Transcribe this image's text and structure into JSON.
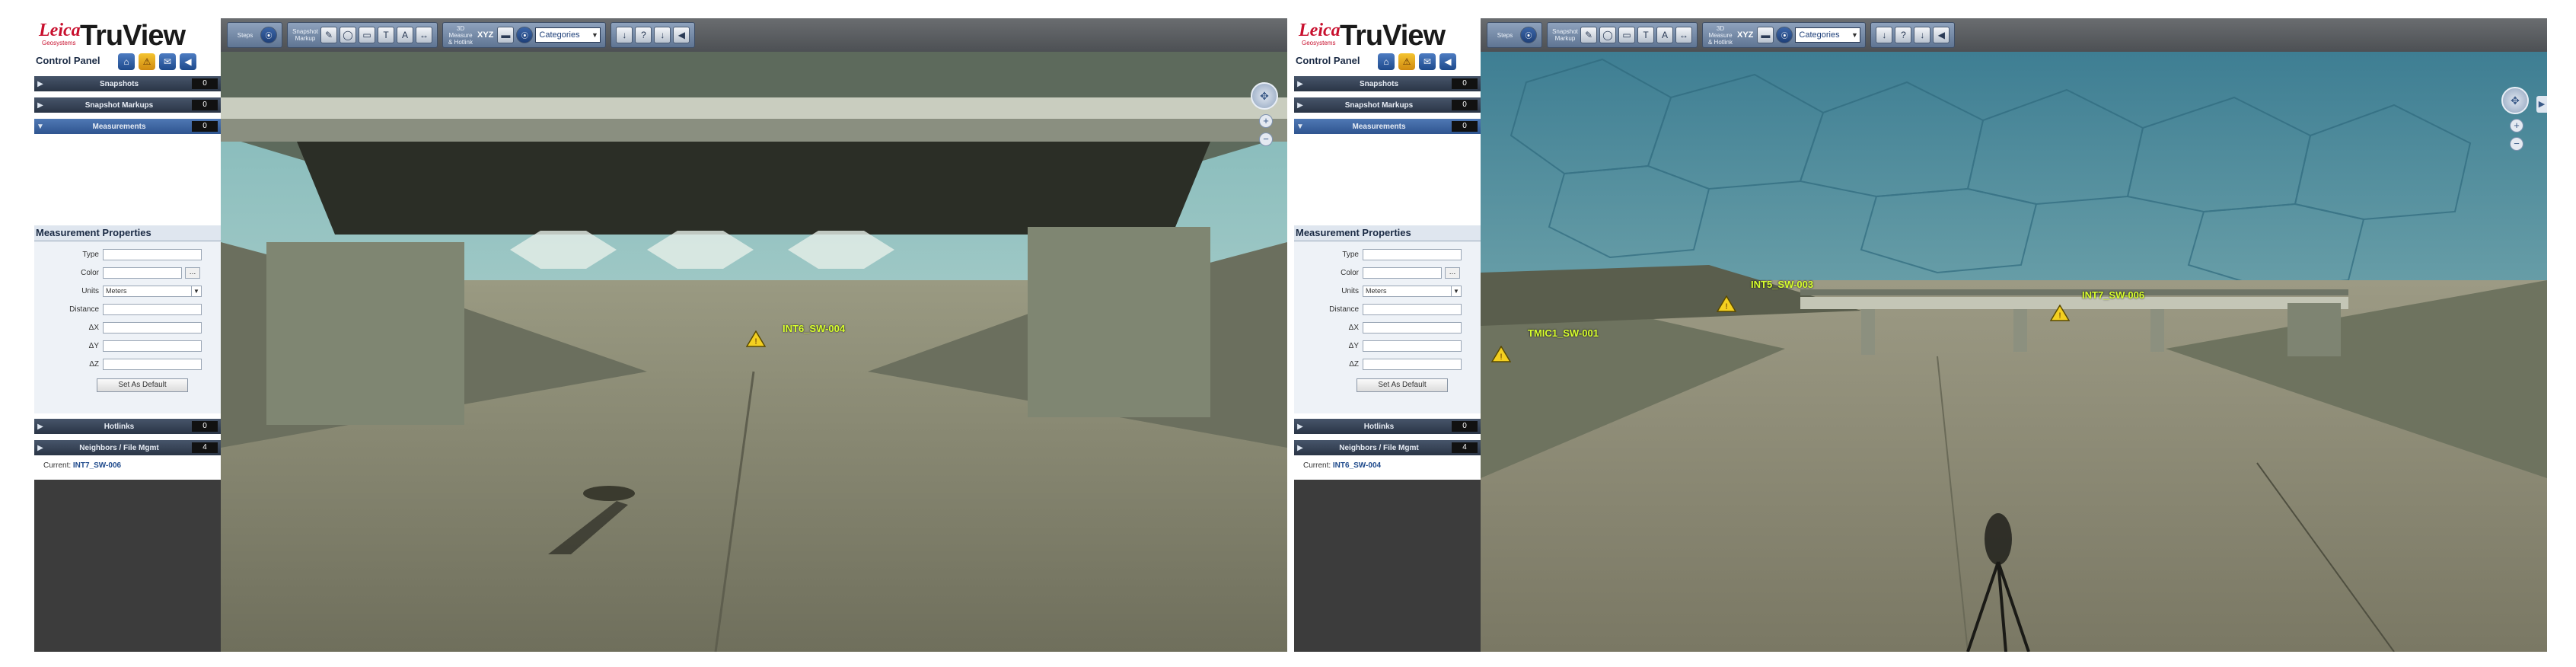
{
  "app": {
    "brand": "Leica",
    "brand_sub": "Geosystems",
    "product": "TruView"
  },
  "toolbar": {
    "groups": [
      {
        "label": "Steps",
        "buttons": [
          "⦿"
        ]
      },
      {
        "label": "Snapshot Markup",
        "buttons": [
          "✎",
          "◯",
          "▭",
          "T",
          "A",
          "↔"
        ]
      },
      {
        "label": "3D Measure & Hotlink",
        "xyz": "XYZ",
        "buttons": [
          "▬",
          "⦿"
        ]
      },
      {
        "select": "Categories"
      },
      {
        "buttons": [
          "↓",
          "?",
          "↓",
          "◀"
        ]
      }
    ]
  },
  "panel": {
    "title": "Control Panel",
    "icons": [
      "home-icon",
      "warning-icon",
      "mail-icon",
      "back-icon"
    ],
    "sections_top": [
      {
        "label": "Snapshots",
        "count": "0"
      },
      {
        "label": "Snapshot Markups",
        "count": "0"
      },
      {
        "label": "Measurements",
        "count": "0"
      }
    ],
    "props_title": "Measurement Properties",
    "props": {
      "type": "Type",
      "color": "Color",
      "units": "Units",
      "units_value": "Meters",
      "distance": "Distance",
      "dx": "ΔX",
      "dy": "ΔY",
      "dz": "ΔZ",
      "default_button": "Set As Default"
    },
    "sections_bottom": [
      {
        "label": "Hotlinks",
        "count": "0"
      },
      {
        "label": "Neighbors / File Mgmt",
        "count": "4"
      }
    ],
    "current_label": "Current:"
  },
  "left": {
    "current": "INT7_SW-006",
    "tags": [
      {
        "text": "INT6_SW-004"
      }
    ]
  },
  "right": {
    "current": "INT6_SW-004",
    "tags": [
      {
        "text": "TMIC1_SW-001"
      },
      {
        "text": "INT5_SW-003"
      },
      {
        "text": "INT7_SW-006"
      }
    ]
  }
}
